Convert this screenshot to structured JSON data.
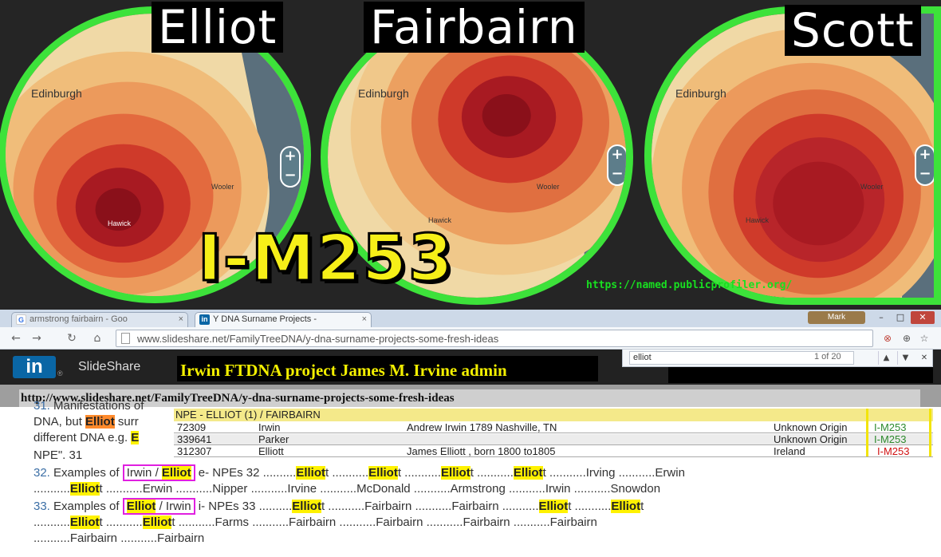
{
  "maps": [
    {
      "title": "Elliot",
      "labels": {
        "edinburgh": "Edinburgh",
        "wooler": "Wooler",
        "hawick": "Hawick"
      }
    },
    {
      "title": "Fairbairn",
      "labels": {
        "edinburgh": "Edinburgh",
        "wooler": "Wooler",
        "hawick": "Hawick"
      }
    },
    {
      "title": "Scott",
      "labels": {
        "edinburgh": "Edinburgh",
        "wooler": "Wooler",
        "hawick": "Hawick"
      }
    }
  ],
  "zoom": {
    "plus": "+",
    "minus": "−"
  },
  "haplogroup": "I-M253",
  "source_url": "https://named.publicprofiler.org/",
  "browser": {
    "tabs": [
      {
        "label": "armstrong fairbairn - Goo",
        "icon": "google-icon",
        "active": false
      },
      {
        "label": "Y DNA Surname Projects - ",
        "icon": "linkedin-icon",
        "active": true
      }
    ],
    "user": "Mark",
    "address": "www.slideshare.net/FamilyTreeDNA/y-dna-surname-projects-some-fresh-ideas",
    "find": {
      "query": "elliot",
      "count": "1 of 20"
    }
  },
  "slideshare": {
    "logo": "in",
    "brand": "SlideShare",
    "caption": "Irwin FTDNA project James M. Irvine admin",
    "page_url": "http://www.slideshare.net/FamilyTreeDNA/y-dna-surname-projects-some-fresh-ideas"
  },
  "npe_table": {
    "header": "NPE - ELLIOT (1) / FAIRBAIRN",
    "rows": [
      {
        "kit": "72309",
        "surname": "Irwin",
        "ancestor": "Andrew Irwin 1789 Nashville, TN",
        "origin": "Unknown Origin",
        "haplogroup": "I-M253"
      },
      {
        "kit": "339641",
        "surname": "Parker",
        "ancestor": "",
        "origin": "Unknown Origin",
        "haplogroup": "I-M253"
      },
      {
        "kit": "312307",
        "surname": "Elliott",
        "ancestor": "James Elliott , born 1800 to1805",
        "origin": "Ireland",
        "haplogroup": "I-M253"
      }
    ]
  },
  "slide_text": {
    "l31_num": "31.",
    "l31_a": " Manifestations of",
    "l31_hidden": "NPE",
    "l31b_a": "DNA, but ",
    "l31b_hl": "Elliot",
    "l31b_b": " surr",
    "l31c_a": "different DNA e.g. ",
    "l31c_hl": "E",
    "l31d": "NPE\". 31",
    "l32_num": "32.",
    "l32_a": " Examples of ",
    "l32_box_a": "Irwin / ",
    "l32_box_hl": "Elliot",
    "l32_b": " e- NPEs 32 ..........",
    "l32_hl1": "Elliot",
    "l32_t1": "t ...........",
    "l32_hl2": "Elliot",
    "l32_t2": "t ...........",
    "l32_hl3": "Elliot",
    "l32_t3": "t ...........",
    "l32_hl4": "Elliot",
    "l32_t4": "t ...........Irving ...........Erwin",
    "l32b_a": "...........",
    "l32b_hl": "Elliot",
    "l32b_b": "t ...........Erwin ...........Nipper ...........Irvine ...........McDonald ...........Armstrong ...........Irwin ...........Snowdon",
    "l33_num": "33.",
    "l33_a": " Examples of ",
    "l33_box_hl": "Elliot",
    "l33_box_b": " / Irwin",
    "l33_b": " i- NPEs 33 ..........",
    "l33_hl1": "Elliot",
    "l33_t1": "t ...........Fairbairn ...........Fairbairn ...........",
    "l33_hl2": "Elliot",
    "l33_t2": "t ...........",
    "l33_hl3": "Elliot",
    "l33_t3": "t",
    "l33b_a": "...........",
    "l33b_hl1": "Elliot",
    "l33b_t1": "t ...........",
    "l33b_hl2": "Elliot",
    "l33b_t2": "t ...........Farms ...........Fairbairn ...........Fairbairn ...........Fairbairn ...........Fairbairn",
    "l33c": "...........Fairbairn ...........Fairbairn"
  }
}
